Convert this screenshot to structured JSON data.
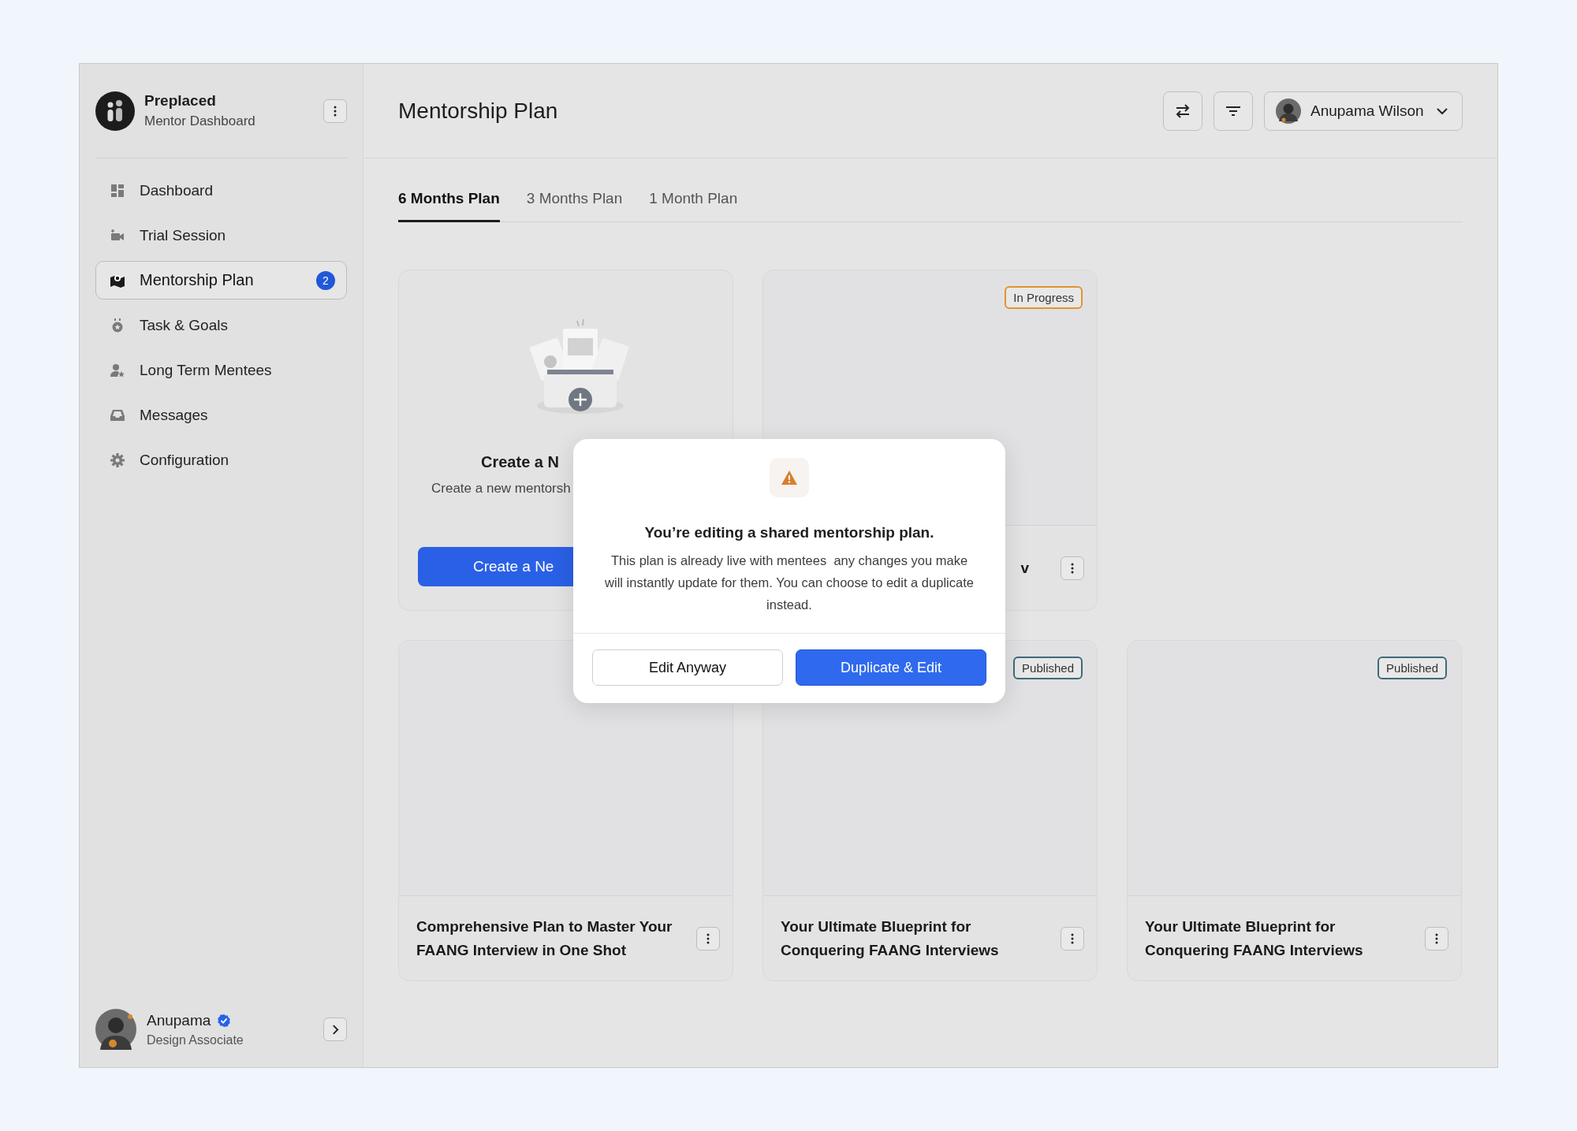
{
  "sidebar": {
    "brand": {
      "name": "Preplaced",
      "subtitle": "Mentor Dashboard"
    },
    "items": [
      {
        "label": "Dashboard",
        "selected": false
      },
      {
        "label": "Trial Session",
        "selected": false
      },
      {
        "label": "Mentorship Plan",
        "selected": true,
        "badge": "2"
      },
      {
        "label": "Task & Goals",
        "selected": false
      },
      {
        "label": "Long Term Mentees",
        "selected": false
      },
      {
        "label": "Messages",
        "selected": false
      },
      {
        "label": "Configuration",
        "selected": false
      }
    ],
    "user": {
      "name": "Anupama",
      "verified": true,
      "role": "Design Associate"
    }
  },
  "header": {
    "title": "Mentorship Plan",
    "user_menu": {
      "name": "Anupama Wilson"
    }
  },
  "tabs": [
    {
      "label": "6 Months Plan",
      "selected": true
    },
    {
      "label": "3 Months Plan",
      "selected": false
    },
    {
      "label": "1 Month Plan",
      "selected": false
    }
  ],
  "card_rows": [
    [
      {
        "kind": "create",
        "title": "Create a N",
        "description": "Create a new mentorsh",
        "button": "Create a Ne"
      },
      {
        "kind": "plan",
        "status": "In Progress",
        "color": "#e0952e",
        "title": "v"
      }
    ],
    [
      {
        "kind": "plan",
        "title": "Comprehensive Plan to Master Your FAANG Interview in One Shot"
      },
      {
        "kind": "plan",
        "status": "Published",
        "color": "#3f6a78",
        "title": "Your Ultimate Blueprint for Conquering FAANG Interviews"
      },
      {
        "kind": "plan",
        "status": "Published",
        "color": "#3f6a78",
        "title": "Your Ultimate Blueprint for Conquering FAANG Interviews"
      }
    ]
  ],
  "modal": {
    "title": "You’re editing a shared mentorship plan.",
    "body": "This plan is already live with mentees  any changes you make will instantly update for them. You can choose to edit a duplicate instead.",
    "buttons": [
      {
        "label": "Edit Anyway",
        "kind": "secondary"
      },
      {
        "label": "Duplicate & Edit",
        "kind": "primary"
      }
    ]
  }
}
